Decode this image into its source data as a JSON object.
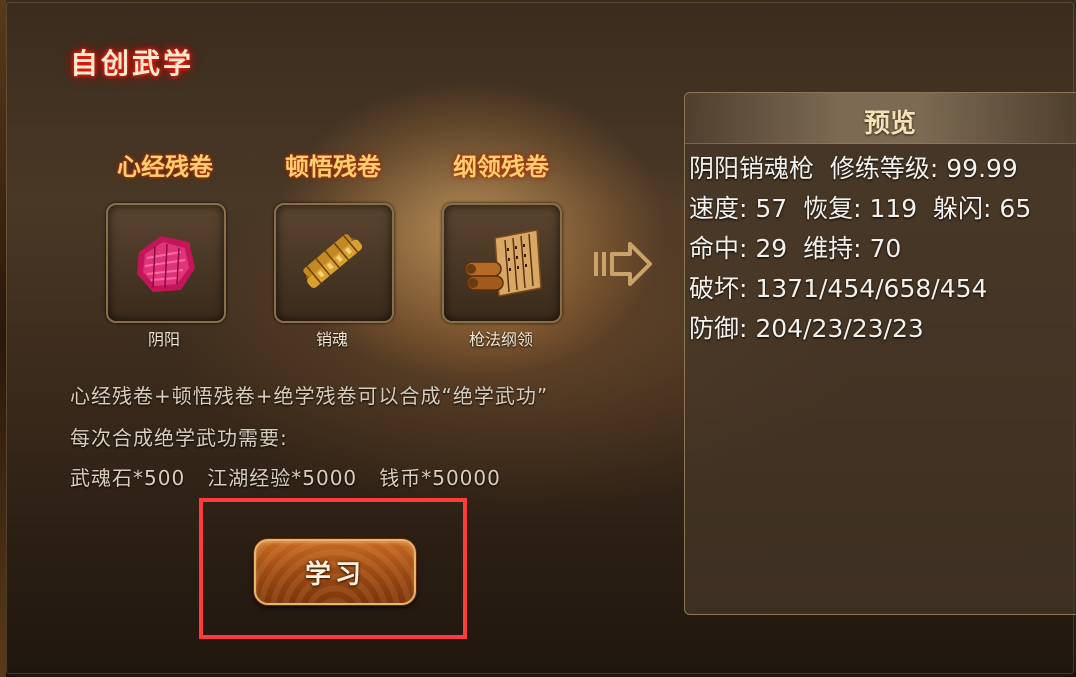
{
  "title": "自创武学",
  "cards": [
    {
      "header": "心经残卷",
      "label": "阴阳",
      "icon": "pink-scroll-icon"
    },
    {
      "header": "顿悟残卷",
      "label": "销魂",
      "icon": "golden-scroll-icon"
    },
    {
      "header": "纲领残卷",
      "label": "枪法纲领",
      "icon": "bamboo-scroll-icon"
    }
  ],
  "arrow_icon": "right-arrow-icon",
  "info": {
    "line1": "心经残卷+顿悟残卷+绝学残卷可以合成“绝学武功”",
    "line2": "每次合成绝学武功需要:",
    "line3": "武魂石*500   江湖经验*5000   钱币*50000"
  },
  "learn_button": "学习",
  "preview": {
    "title": "预览",
    "lines": [
      "阴阳销魂枪  修练等级: 99.99",
      "速度: 57  恢复: 119  躲闪: 65",
      "命中: 29  维持: 70",
      "破坏: 1371/454/658/454",
      "防御: 204/23/23/23"
    ]
  },
  "colors": {
    "header_gold": "#ffcf72",
    "button_orange": "#9c4a14",
    "highlight_red": "#ff3b3b",
    "title_glow": "#d80f00"
  }
}
